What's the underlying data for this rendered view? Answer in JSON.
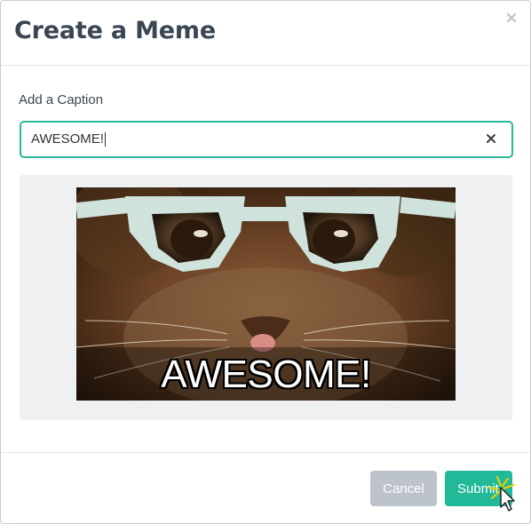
{
  "dialog": {
    "title": "Create a Meme",
    "close_icon": "close-icon"
  },
  "form": {
    "caption_label": "Add a Caption",
    "caption_value": "AWESOME!",
    "clear_icon": "clear-icon"
  },
  "preview": {
    "image_description_icon": "cat-glasses-image",
    "caption_overlay": "AWESOME!"
  },
  "footer": {
    "cancel_label": "Cancel",
    "submit_label": "Submit"
  },
  "colors": {
    "accent": "#22b999",
    "cancel": "#bcc3ca",
    "title": "#3a4652"
  }
}
